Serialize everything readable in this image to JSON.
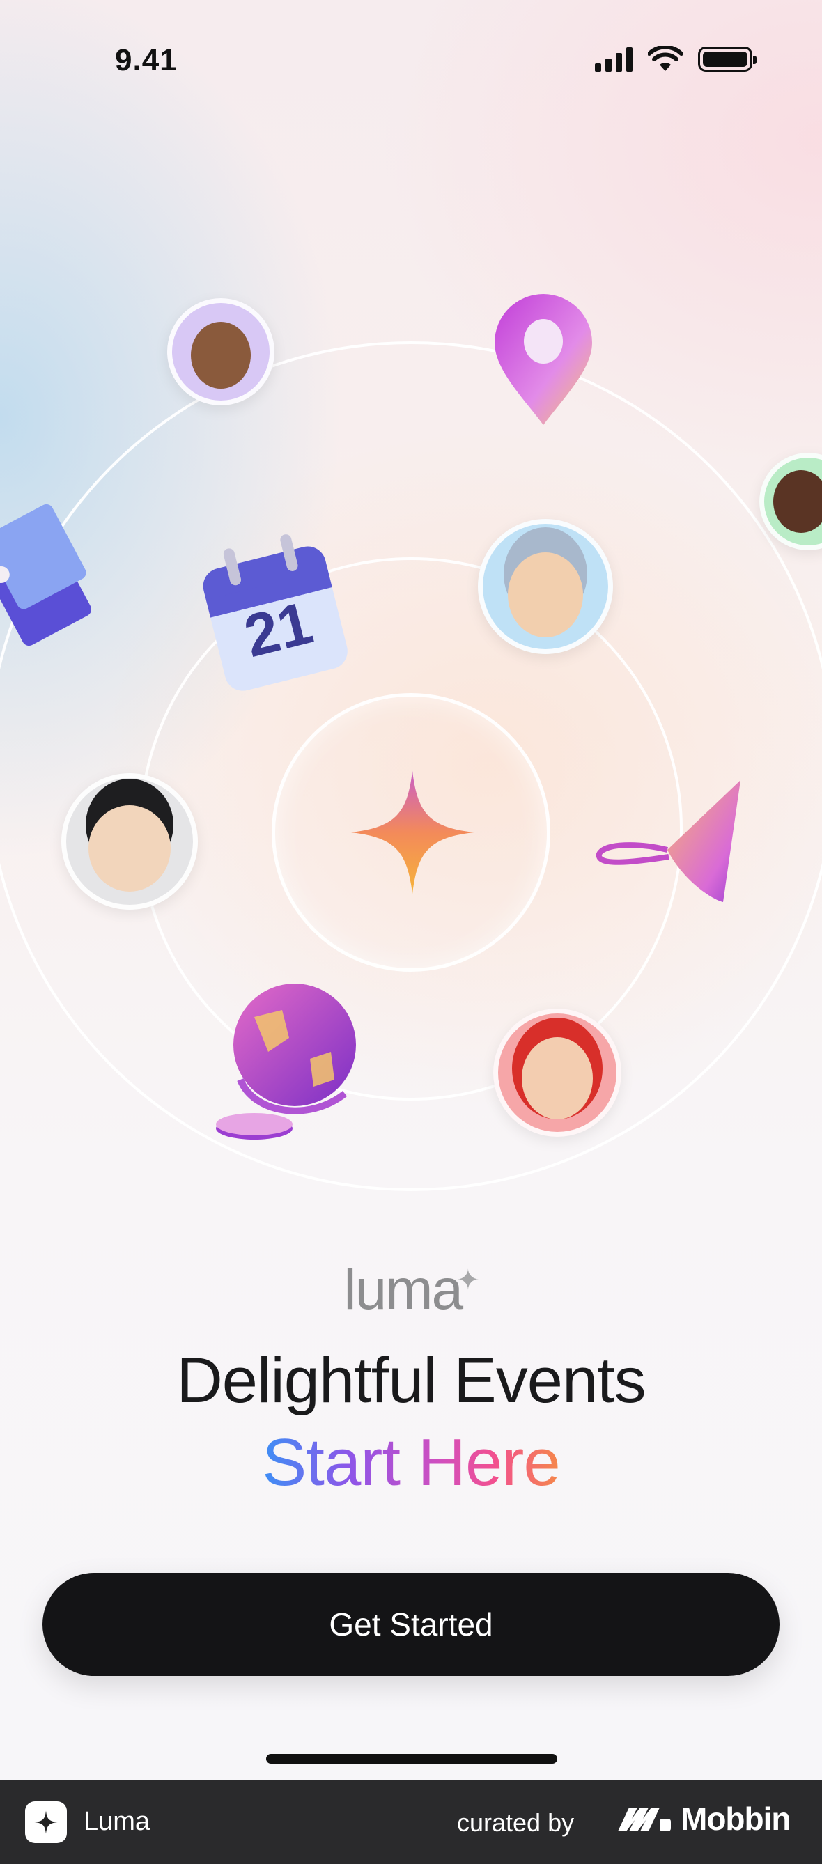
{
  "status_bar": {
    "time": "9.41"
  },
  "brand": {
    "logo": "luma",
    "logo_mark": "✦"
  },
  "hero": {
    "headline": "Delightful Events",
    "subheadline": "Start Here"
  },
  "cta": {
    "label": "Get Started"
  },
  "icons": [
    "sparkle-icon",
    "calendar-icon",
    "location-pin-icon",
    "ticket-icon",
    "globe-icon",
    "party-hat-icon"
  ],
  "calendar": {
    "day": "21"
  },
  "footer": {
    "app_name": "Luma",
    "curated_by": "curated by",
    "brand": "Mobbin"
  },
  "colors": {
    "button": "#141416",
    "gradient_start": "#3d8ff5",
    "gradient_end": "#f5884a"
  }
}
